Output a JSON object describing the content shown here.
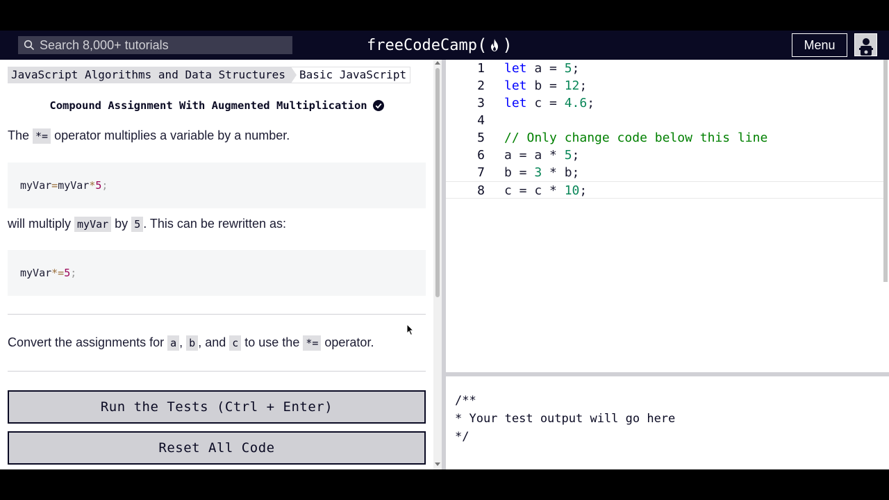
{
  "navbar": {
    "search_placeholder": "Search 8,000+ tutorials",
    "logo_text": "freeCodeCamp",
    "logo_open": "(",
    "logo_close": ")",
    "menu_label": "Menu"
  },
  "breadcrumb": {
    "curriculum": "JavaScript Algorithms and Data Structures",
    "section": "Basic JavaScript"
  },
  "challenge": {
    "title": "Compound Assignment With Augmented Multiplication",
    "p1_before": "The ",
    "p1_code": "*=",
    "p1_after": " operator multiplies a variable by a number.",
    "code1": {
      "a": "myVar",
      "eq": " = ",
      "b": "myVar",
      "op": " * ",
      "n": "5",
      "semi": ";"
    },
    "p2_before": "will multiply ",
    "p2_code1": "myVar",
    "p2_mid": " by ",
    "p2_code2": "5",
    "p2_after": ". This can be rewritten as:",
    "code2": {
      "a": "myVar",
      "op": " *= ",
      "n": "5",
      "semi": ";"
    },
    "p3_before": "Convert the assignments for ",
    "p3_a": "a",
    "p3_comma1": ", ",
    "p3_b": "b",
    "p3_and": ", and ",
    "p3_c": "c",
    "p3_mid": " to use the ",
    "p3_op": "*=",
    "p3_after": " operator."
  },
  "buttons": {
    "run": "Run the Tests (Ctrl + Enter)",
    "reset": "Reset All Code"
  },
  "editor": {
    "lines": [
      {
        "n": "1",
        "kw": "let",
        "rest": " a = ",
        "num": "5",
        "end": ";"
      },
      {
        "n": "2",
        "kw": "let",
        "rest": " b = ",
        "num": "12",
        "end": ";"
      },
      {
        "n": "3",
        "kw": "let",
        "rest": " c = ",
        "num": "4.6",
        "end": ";"
      },
      {
        "n": "4"
      },
      {
        "n": "5",
        "comment": "// Only change code below this line"
      },
      {
        "n": "6",
        "rest": "a = a * ",
        "num": "5",
        "end": ";"
      },
      {
        "n": "7",
        "rest": "b = ",
        "num": "3",
        "end": " * b;"
      },
      {
        "n": "8",
        "rest": "c = c * ",
        "num": "10",
        "end": ";"
      }
    ]
  },
  "output": {
    "l1": "/**",
    "l2": "* Your test output will go here",
    "l3": "*/"
  },
  "colors": {
    "nav_bg": "#0a0a23",
    "keyword": "#0000ff",
    "number": "#098658",
    "comment": "#008000"
  },
  "icons": [
    "search-icon",
    "flame-icon",
    "avatar-icon",
    "check-circle-icon",
    "mouse-pointer-icon"
  ]
}
